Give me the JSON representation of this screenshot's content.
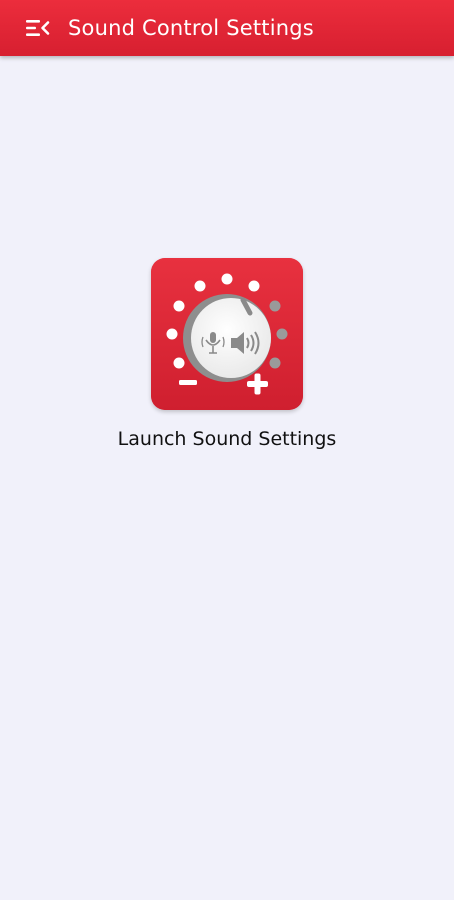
{
  "app_bar": {
    "title": "Sound Control Settings",
    "menu_icon": "menu-open-icon",
    "color": "#e2293a"
  },
  "launcher": {
    "icon": "volume-knob-icon",
    "label": "Launch Sound Settings",
    "icon_color": "#dc2535"
  }
}
